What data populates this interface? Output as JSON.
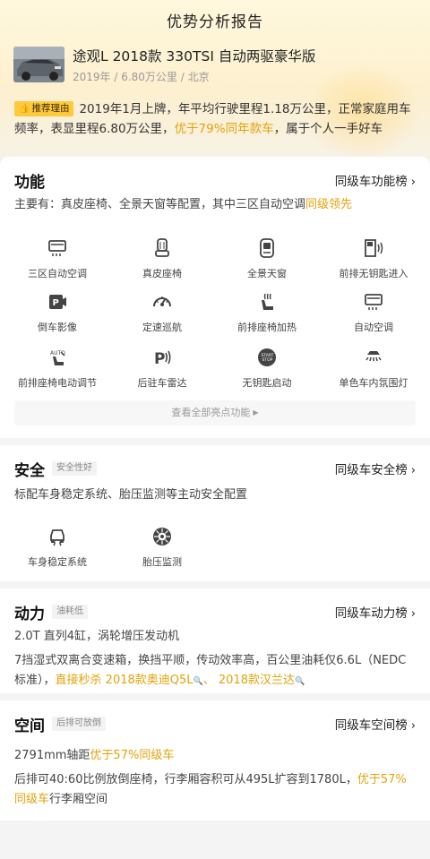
{
  "header": {
    "title": "优势分析报告",
    "car_name": "途观L 2018款 330TSI 自动两驱豪华版",
    "car_meta": "2019年 / 6.80万公里 / 北京",
    "reco_tag": "推荐理由",
    "reco_text_1": "2019年1月上牌，年平均行驶里程1.18万公里，正常家庭用车频率，表显里程6.80万公里，",
    "reco_highlight": "优于79%同年款车",
    "reco_text_2": "，属于个人一手好车"
  },
  "function": {
    "title": "功能",
    "link": "同级车功能榜",
    "summary_prefix": "主要有：真皮座椅、全景天窗等配置，其中三区自动空调",
    "summary_highlight": "同级领先",
    "items": [
      {
        "label": "三区自动空调",
        "icon": "ac-icon"
      },
      {
        "label": "真皮座椅",
        "icon": "seat-icon"
      },
      {
        "label": "全景天窗",
        "icon": "sunroof-icon"
      },
      {
        "label": "前排无钥匙进入",
        "icon": "keyless-entry-icon"
      },
      {
        "label": "倒车影像",
        "icon": "reverse-camera-icon"
      },
      {
        "label": "定速巡航",
        "icon": "cruise-icon"
      },
      {
        "label": "前排座椅加热",
        "icon": "seat-heat-icon"
      },
      {
        "label": "自动空调",
        "icon": "auto-ac-icon"
      },
      {
        "label": "前排座椅电动调节",
        "icon": "power-seat-icon"
      },
      {
        "label": "后驻车雷达",
        "icon": "parking-radar-icon"
      },
      {
        "label": "无钥匙启动",
        "icon": "keyless-start-icon"
      },
      {
        "label": "单色车内氛围灯",
        "icon": "ambient-light-icon"
      }
    ],
    "view_all": "查看全部亮点功能"
  },
  "safety": {
    "title": "安全",
    "badge": "安全性好",
    "link": "同级车安全榜",
    "summary": "标配车身稳定系统、胎压监测等主动安全配置",
    "items": [
      {
        "label": "车身稳定系统",
        "icon": "esp-icon"
      },
      {
        "label": "胎压监测",
        "icon": "tire-pressure-icon"
      }
    ]
  },
  "power": {
    "title": "动力",
    "badge": "油耗低",
    "link": "同级车动力榜",
    "line1": "2.0T 直列4缸，涡轮增压发动机",
    "line2_prefix": "7挡湿式双离合变速箱，换挡平顺，传动效率高，百公里油耗仅6.6L（NEDC标准），",
    "line2_hl1": "直接秒杀",
    "line2_hl2": "2018款奥迪Q5L",
    "line2_sep": "、",
    "line2_hl3": "2018款汉兰达"
  },
  "space": {
    "title": "空间",
    "badge": "后排可放倒",
    "link": "同级车空间榜",
    "line1_prefix": "2791mm轴距",
    "line1_hl": "优于57%同级车",
    "line2_prefix": "后排可40:60比例放倒座椅，行李厢容积可从495L扩容到1780L，",
    "line2_hl": "优于57%同级车",
    "line2_suffix": "行李厢空间"
  }
}
